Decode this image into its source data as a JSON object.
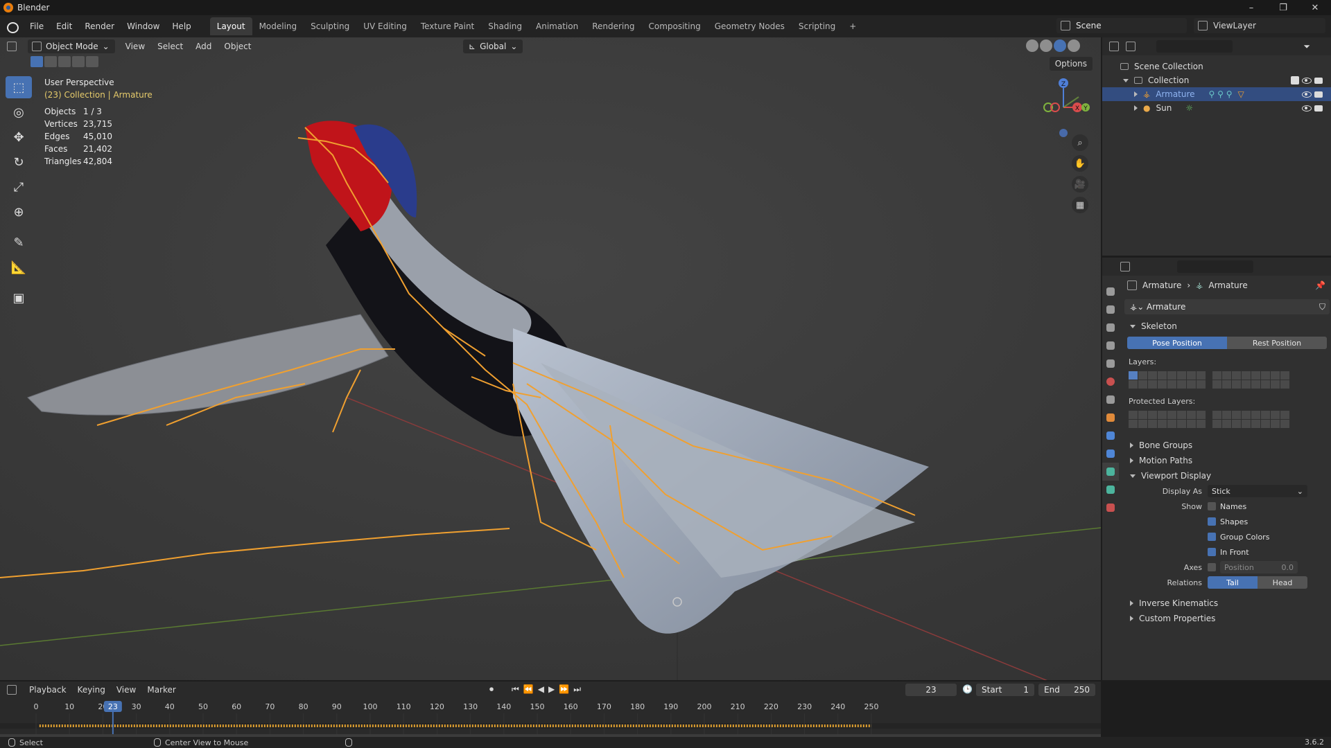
{
  "window": {
    "title": "Blender"
  },
  "menu": [
    "File",
    "Edit",
    "Render",
    "Window",
    "Help"
  ],
  "workspaces": [
    "Layout",
    "Modeling",
    "Sculpting",
    "UV Editing",
    "Texture Paint",
    "Shading",
    "Animation",
    "Rendering",
    "Compositing",
    "Geometry Nodes",
    "Scripting",
    "+"
  ],
  "active_workspace": "Layout",
  "scene": {
    "label": "Scene"
  },
  "viewlayer": {
    "label": "ViewLayer"
  },
  "viewport": {
    "mode": "Object Mode",
    "menus": [
      "View",
      "Select",
      "Add",
      "Object"
    ],
    "transform_orientation": "Global",
    "options_label": "Options",
    "perspective": "User Perspective",
    "collection_info": "(23) Collection | Armature",
    "stats": [
      {
        "label": "Objects",
        "value": "1 / 3"
      },
      {
        "label": "Vertices",
        "value": "23,715"
      },
      {
        "label": "Edges",
        "value": "45,010"
      },
      {
        "label": "Faces",
        "value": "21,402"
      },
      {
        "label": "Triangles",
        "value": "42,804"
      }
    ],
    "gizmo_axes": {
      "z": "Z",
      "x": "X",
      "y": "Y"
    }
  },
  "outliner": {
    "root": "Scene Collection",
    "collection": "Collection",
    "items": [
      {
        "name": "Armature",
        "selected": true
      },
      {
        "name": "Sun",
        "selected": false
      }
    ]
  },
  "properties": {
    "breadcrumb": [
      "Armature",
      "Armature"
    ],
    "data_name": "Armature",
    "skeleton_label": "Skeleton",
    "pose_position": "Pose Position",
    "rest_position": "Rest Position",
    "layers_label": "Layers:",
    "protected_layers_label": "Protected Layers:",
    "panels_collapsed": [
      "Bone Groups",
      "Motion Paths"
    ],
    "viewport_display": {
      "title": "Viewport Display",
      "display_as_label": "Display As",
      "display_as_value": "Stick",
      "show_label": "Show",
      "names": {
        "label": "Names",
        "checked": false
      },
      "shapes": {
        "label": "Shapes",
        "checked": true
      },
      "group_colors": {
        "label": "Group Colors",
        "checked": true
      },
      "in_front": {
        "label": "In Front",
        "checked": true
      },
      "axes_label": "Axes",
      "axes_position_label": "Position",
      "axes_position_value": "0.0",
      "relations_label": "Relations",
      "tail": "Tail",
      "head": "Head"
    },
    "panels_bottom": [
      "Inverse Kinematics",
      "Custom Properties"
    ]
  },
  "timeline": {
    "menus": [
      "Playback",
      "Keying",
      "View",
      "Marker"
    ],
    "current_frame": "23",
    "start_label": "Start",
    "start": "1",
    "end_label": "End",
    "end": "250",
    "ruler": [
      "0",
      "10",
      "20",
      "30",
      "40",
      "50",
      "60",
      "70",
      "80",
      "90",
      "100",
      "110",
      "120",
      "130",
      "140",
      "150",
      "160",
      "170",
      "180",
      "190",
      "200",
      "210",
      "220",
      "230",
      "240",
      "250"
    ]
  },
  "statusbar": {
    "select": "Select",
    "center_view": "Center View to Mouse",
    "version": "3.6.2"
  },
  "colors": {
    "accent": "#4772b3",
    "bone": "#f0a030",
    "header": "#232323",
    "viewport_bg": "#3a3a3a"
  }
}
